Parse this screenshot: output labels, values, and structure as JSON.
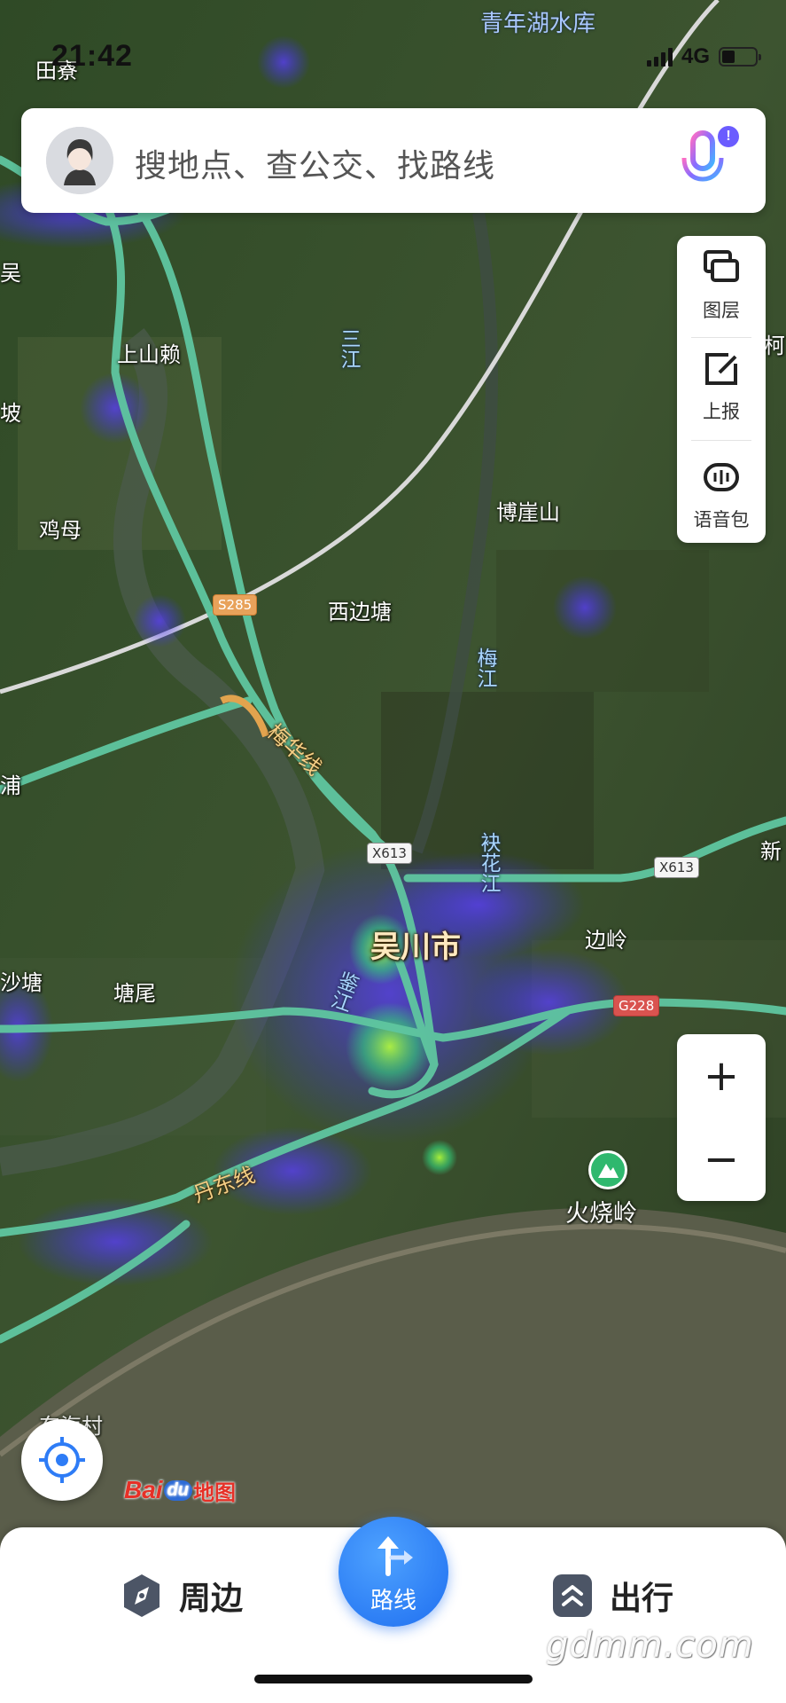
{
  "status_bar": {
    "time": "21:42",
    "network": "4G",
    "battery_level": 0.4
  },
  "search": {
    "placeholder": "搜地点、查公交、找路线",
    "voice_badge": "!"
  },
  "tools": {
    "layers_label": "图层",
    "report_label": "上报",
    "voice_pack_label": "语音包"
  },
  "zoom": {
    "in_label": "+",
    "out_label": "−"
  },
  "map": {
    "labels": {
      "reservoir": "青年湖水库",
      "tianliao": "田寮",
      "wu": "吴",
      "shangshanlai": "上山赖",
      "sanjiang": "三江",
      "po": "坡",
      "jimu": "鸡母",
      "boyashan": "博崖山",
      "xibiantang": "西边塘",
      "meijiang": "梅江",
      "meihua": "梅华线",
      "suohuajiang": "袂花江",
      "wuchuan": "吴川市",
      "bianling": "边岭",
      "xin": "新",
      "shatang": "沙塘",
      "tangwei": "塘尾",
      "jianjiang": "鉴江",
      "dandong": "丹东线",
      "huoshaoling": "火烧岭",
      "dongjiacun": "东海村",
      "ke": "柯",
      "pu": "浦"
    },
    "shields": {
      "s285": "S285",
      "x613_a": "X613",
      "x613_b": "X613",
      "g228": "G228"
    }
  },
  "brand": {
    "bai": "Bai",
    "du": "du",
    "ditu": "地图"
  },
  "bottom_nav": {
    "nearby_label": "周边",
    "route_label": "路线",
    "travel_label": "出行"
  },
  "watermark": "gdmm.com"
}
